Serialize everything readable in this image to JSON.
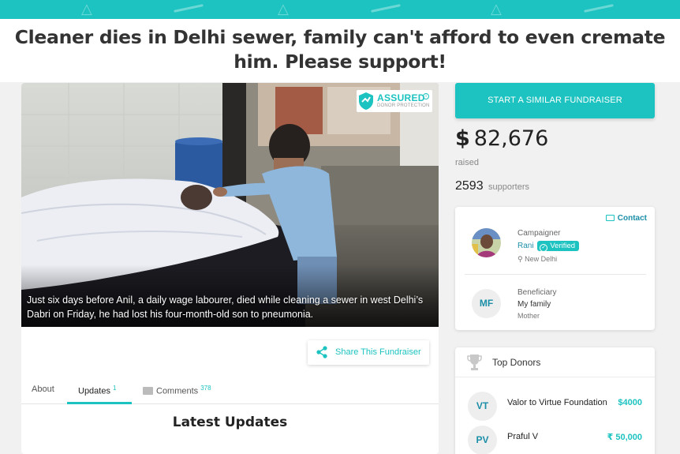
{
  "colors": {
    "accent": "#1cc3c0",
    "link": "#1c8fa8",
    "top_band": "#1cc3c0"
  },
  "page": {
    "title": "Cleaner dies in Delhi sewer, family can't afford to even cremate him. Please support!"
  },
  "hero": {
    "caption": "Just six days before Anil, a daily wage labourer, died while cleaning a sewer in west Delhi’s Dabri on Friday, he had lost his four-month-old son to pneumonia.",
    "badge": {
      "title": "ASSURED",
      "subtitle": "DONOR PROTECTION",
      "icon": "shield-icon",
      "info": "i"
    }
  },
  "share": {
    "label": "Share This Fundraiser",
    "icon": "share-icon"
  },
  "tabs": [
    {
      "label": "About"
    },
    {
      "label": "Updates",
      "count": "1"
    },
    {
      "label": "Comments",
      "count": "378",
      "icon": "comment-icon"
    }
  ],
  "latest_updates": "Latest Updates",
  "sidebar": {
    "start_button": "START A SIMILAR FUNDRAISER",
    "currency": "$",
    "raised_amount": "82,676",
    "raised_label": "raised",
    "supporters_count": "2593",
    "supporters_label": "supporters"
  },
  "campaign_card": {
    "contact": "Contact",
    "campaigner_label": "Campaigner",
    "campaigner_name": "Rani",
    "verified": "Verified",
    "location": "New Delhi",
    "beneficiary_initials": "MF",
    "beneficiary_label": "Beneficiary",
    "beneficiary_name": "My family",
    "beneficiary_relation": "Mother"
  },
  "top_donors": {
    "title": "Top Donors",
    "donors": [
      {
        "initials": "VT",
        "name": "Valor to Virtue Foundation",
        "amount": "$4000"
      },
      {
        "initials": "PV",
        "name": "Praful V",
        "amount": "₹ 50,000"
      }
    ]
  }
}
